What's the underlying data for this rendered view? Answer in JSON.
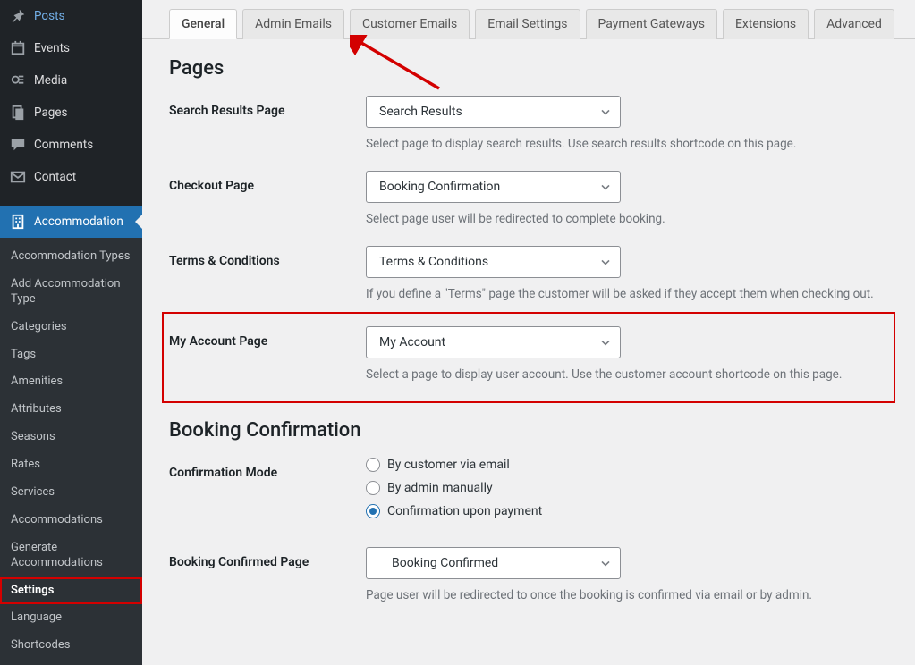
{
  "sidebar": {
    "main": [
      {
        "label": "Posts"
      },
      {
        "label": "Events"
      },
      {
        "label": "Media"
      },
      {
        "label": "Pages"
      },
      {
        "label": "Comments"
      },
      {
        "label": "Contact"
      },
      {
        "label": "Accommodation"
      }
    ],
    "sub": [
      {
        "label": "Accommodation Types"
      },
      {
        "label": "Add Accommodation Type"
      },
      {
        "label": "Categories"
      },
      {
        "label": "Tags"
      },
      {
        "label": "Amenities"
      },
      {
        "label": "Attributes"
      },
      {
        "label": "Seasons"
      },
      {
        "label": "Rates"
      },
      {
        "label": "Services"
      },
      {
        "label": "Accommodations"
      },
      {
        "label": "Generate Accommodations"
      },
      {
        "label": "Settings"
      },
      {
        "label": "Language"
      },
      {
        "label": "Shortcodes"
      }
    ]
  },
  "tabs": [
    {
      "label": "General"
    },
    {
      "label": "Admin Emails"
    },
    {
      "label": "Customer Emails"
    },
    {
      "label": "Email Settings"
    },
    {
      "label": "Payment Gateways"
    },
    {
      "label": "Extensions"
    },
    {
      "label": "Advanced"
    }
  ],
  "sections": {
    "pages_title": "Pages",
    "booking_title": "Booking Confirmation"
  },
  "fields": {
    "search_results": {
      "label": "Search Results Page",
      "value": "Search Results",
      "desc": "Select page to display search results. Use search results shortcode on this page."
    },
    "checkout": {
      "label": "Checkout Page",
      "value": "Booking Confirmation",
      "desc": "Select page user will be redirected to complete booking."
    },
    "terms": {
      "label": "Terms & Conditions",
      "value": "Terms & Conditions",
      "desc": "If you define a \"Terms\" page the customer will be asked if they accept them when checking out."
    },
    "my_account": {
      "label": "My Account Page",
      "value": "My Account",
      "desc": "Select a page to display user account. Use the customer account shortcode on this page."
    },
    "confirm_mode": {
      "label": "Confirmation Mode",
      "options": [
        "By customer via email",
        "By admin manually",
        "Confirmation upon payment"
      ]
    },
    "booking_confirmed": {
      "label": "Booking Confirmed Page",
      "value": "Booking Confirmed",
      "desc": "Page user will be redirected to once the booking is confirmed via email or by admin."
    }
  }
}
